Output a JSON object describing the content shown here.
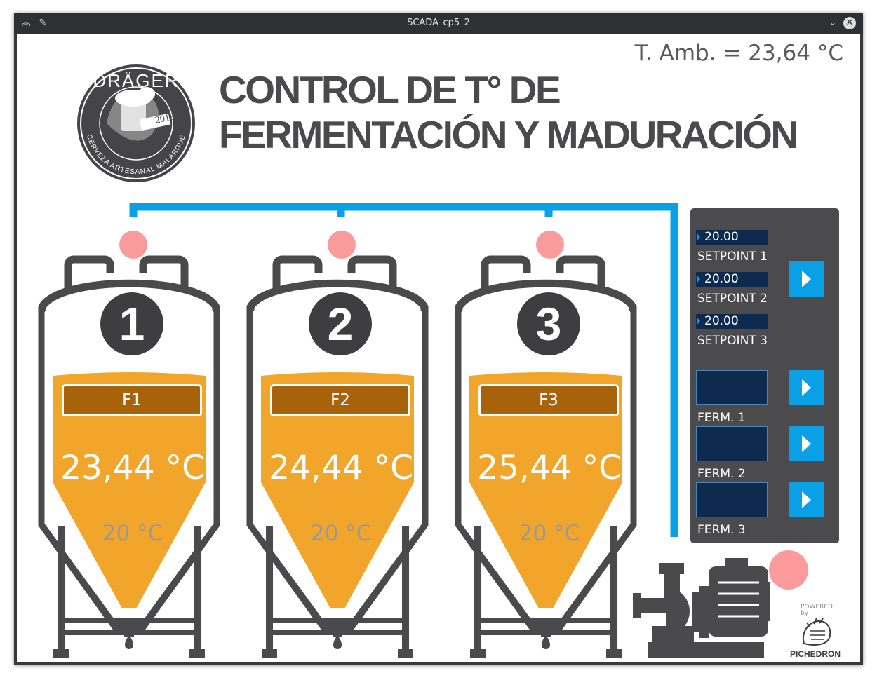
{
  "window": {
    "title": "SCADA_cp5_2"
  },
  "ambient": {
    "text": "T. Amb. = 23,64 °C"
  },
  "header": {
    "title_line1": "CONTROL DE T° DE",
    "title_line2": "FERMENTACIÓN Y MADURACIÓN"
  },
  "logo": {
    "brand": "DRÄGER",
    "year": "2013",
    "subtitle": "CERVEZA ARTESANAL MALARGÜE"
  },
  "tanks": [
    {
      "number": "1",
      "label": "F1",
      "temperature": "23,44 °C",
      "setpoint": "20 °C"
    },
    {
      "number": "2",
      "label": "F2",
      "temperature": "24,44 °C",
      "setpoint": "20 °C"
    },
    {
      "number": "3",
      "label": "F3",
      "temperature": "25,44 °C",
      "setpoint": "20 °C"
    }
  ],
  "panel": {
    "setpoints": [
      {
        "value": "20.00",
        "label": "SETPOINT 1"
      },
      {
        "value": "20.00",
        "label": "SETPOINT 2"
      },
      {
        "value": "20.00",
        "label": "SETPOINT 3"
      }
    ],
    "ferms": [
      {
        "label": "FERM. 1"
      },
      {
        "label": "FERM. 2"
      },
      {
        "label": "FERM. 3"
      }
    ]
  },
  "footer": {
    "powered": "POWERED",
    "by": "by",
    "brand": "PICHEDRON"
  },
  "colors": {
    "pipe": "#0aa0e8",
    "tank_outline": "#4a4a4c",
    "liquid": "#f2a52b",
    "label_bg": "#a8630a",
    "indicator": "#fa9a9a",
    "panel_bg": "#4b4b4d",
    "field_bg": "#0e2a4f",
    "button": "#0aa0e8"
  }
}
